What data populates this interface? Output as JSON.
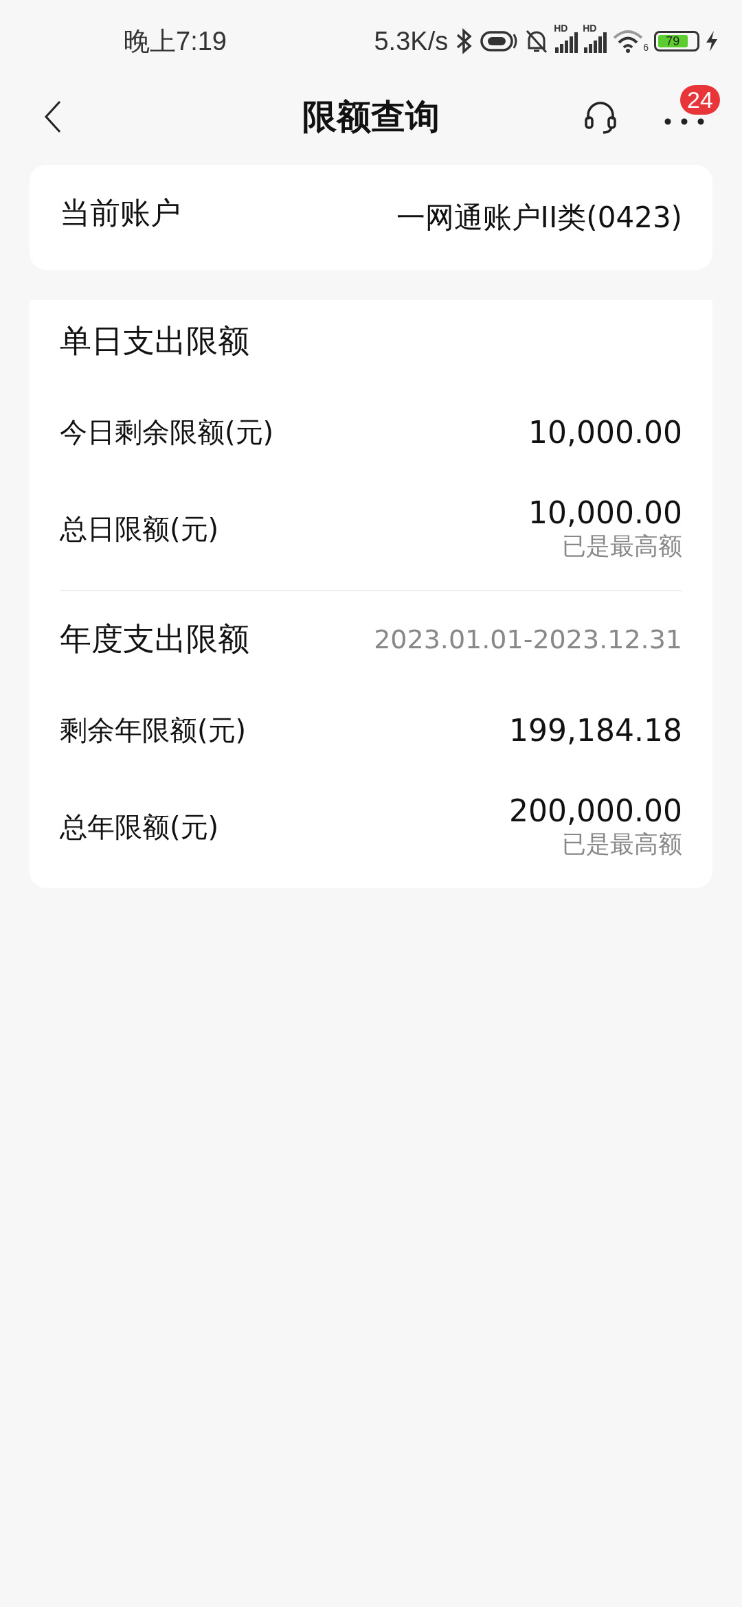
{
  "status_bar": {
    "time": "晚上7:19",
    "network_speed": "5.3K/s",
    "signal_labels": [
      "HD",
      "HD"
    ],
    "wifi_label": "6",
    "battery": "79"
  },
  "header": {
    "title": "限额查询",
    "badge": "24"
  },
  "account": {
    "label": "当前账户",
    "value": "一网通账户II类(0423)"
  },
  "sections": [
    {
      "title": "单日支出限额",
      "rows": [
        {
          "label": "今日剩余限额(元)",
          "value": "10,000.00"
        },
        {
          "label": "总日限额(元)",
          "value": "10,000.00",
          "note": "已是最高额"
        }
      ]
    },
    {
      "title": "年度支出限额",
      "period": "2023.01.01-2023.12.31",
      "rows": [
        {
          "label": "剩余年限额(元)",
          "value": "199,184.18"
        },
        {
          "label": "总年限额(元)",
          "value": "200,000.00",
          "note": "已是最高额"
        }
      ]
    }
  ]
}
